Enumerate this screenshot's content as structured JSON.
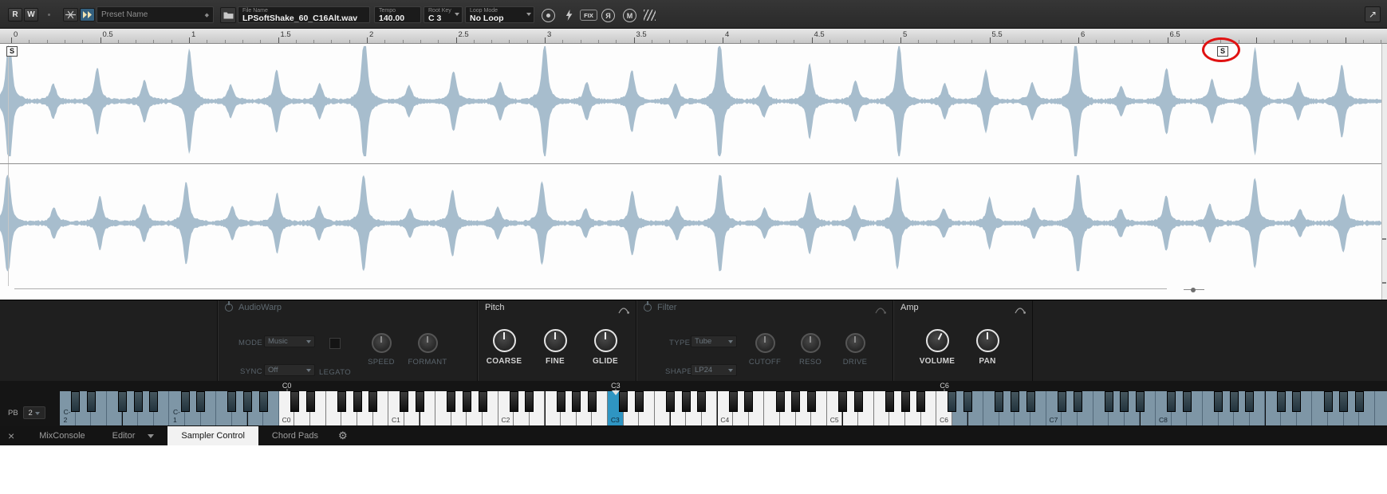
{
  "icons": {
    "close": "×",
    "gear": "⚙",
    "maximize": "↗",
    "reverse": "Я",
    "mono": "M",
    "preset_tag": "◆"
  },
  "toolbar": {
    "read": "R",
    "write": "W",
    "preset_placeholder": "Preset Name",
    "file_label": "File Name",
    "file_value": "LPSoftShake_60_C16Alt.wav",
    "tempo_label": "Tempo",
    "tempo_value": "140.00",
    "root_key_label": "Root Key",
    "root_key_value": "C 3",
    "loop_mode_label": "Loop Mode",
    "loop_mode_value": "No Loop",
    "fix": "FIX"
  },
  "ruler": {
    "labels": [
      "0",
      "0.5",
      "1",
      "1.5",
      "2",
      "2.5",
      "3",
      "3.5",
      "4",
      "4.5",
      "5",
      "5.5",
      "6",
      "6.5"
    ]
  },
  "waveform": {
    "color": "#a7bdcd",
    "start_flag": "S",
    "end_flag": "S"
  },
  "panel": {
    "sections": [
      {
        "title": "AudioWarp",
        "enabled": false,
        "mode_label": "MODE",
        "mode_value": "Music",
        "sync_label": "SYNC",
        "sync_value": "Off",
        "legato_label": "LEGATO",
        "knobs": [
          {
            "label": "SPEED"
          },
          {
            "label": "FORMANT"
          }
        ]
      },
      {
        "title": "Pitch",
        "enabled": true,
        "knobs": [
          {
            "label": "COARSE"
          },
          {
            "label": "FINE"
          },
          {
            "label": "GLIDE"
          }
        ]
      },
      {
        "title": "Filter",
        "enabled": false,
        "type_label": "TYPE",
        "type_value": "Tube",
        "shape_label": "SHAPE",
        "shape_value": "LP24",
        "knobs": [
          {
            "label": "CUTOFF"
          },
          {
            "label": "RESO"
          },
          {
            "label": "DRIVE"
          }
        ]
      },
      {
        "title": "Amp",
        "enabled": true,
        "knobs": [
          {
            "label": "VOLUME"
          },
          {
            "label": "PAN"
          }
        ]
      }
    ]
  },
  "keyboard": {
    "pb_label": "PB",
    "pb_value": "2",
    "octave_labels": [
      "C-2",
      "C-1",
      "C0",
      "C1",
      "C2",
      "C3",
      "C4",
      "C5",
      "C6",
      "C7",
      "C8"
    ],
    "range": {
      "low": "C0",
      "root": "C3",
      "high": "C6"
    }
  },
  "tabbar": {
    "tabs": [
      {
        "label": "MixConsole"
      },
      {
        "label": "Editor"
      },
      {
        "label": "Sampler Control"
      },
      {
        "label": "Chord Pads"
      }
    ]
  }
}
